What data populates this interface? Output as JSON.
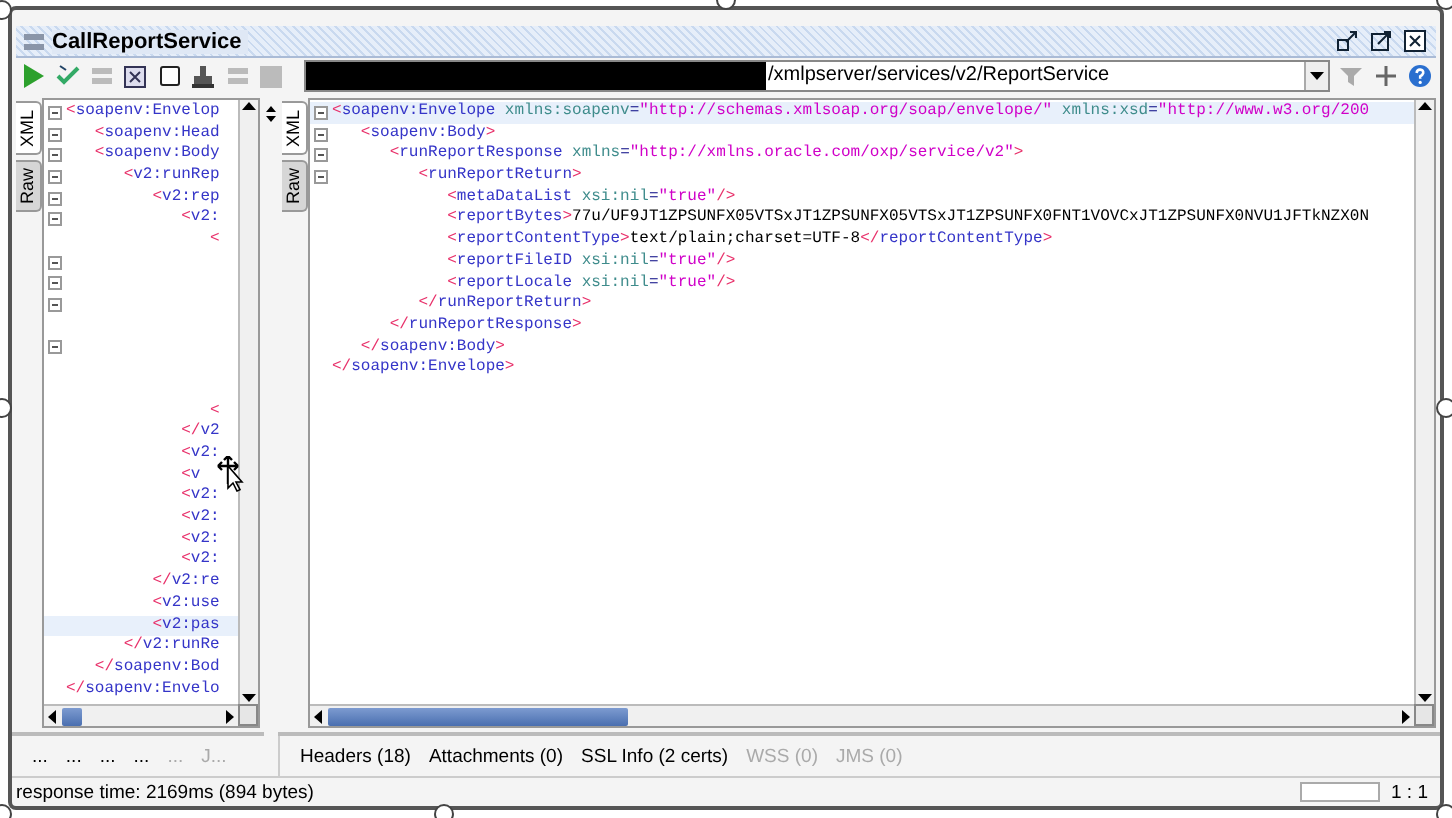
{
  "window": {
    "title": "CallReportService"
  },
  "toolbar": {
    "url": "/xmlpserver/services/v2/ReportService",
    "url_redacted": true
  },
  "request_editor": {
    "tabs": [
      {
        "label": "XML",
        "selected": true
      },
      {
        "label": "Raw",
        "selected": false
      }
    ],
    "lines": [
      {
        "fold": true,
        "segments": [
          {
            "kind": "bracket",
            "text": "<"
          },
          {
            "kind": "tag",
            "text": "soapenv:Envelop"
          }
        ],
        "children": [
          {
            "fold": true,
            "segments": [
              {
                "kind": "bracket",
                "text": "<"
              },
              {
                "kind": "tag",
                "text": "soapenv:Head"
              }
            ]
          },
          {
            "fold": true,
            "segments": [
              {
                "kind": "bracket",
                "text": "<"
              },
              {
                "kind": "tag",
                "text": "soapenv:Body"
              }
            ],
            "children": [
              {
                "fold": true,
                "segments": [
                  {
                    "kind": "bracket",
                    "text": "<"
                  },
                  {
                    "kind": "tag",
                    "text": "v2:runRep"
                  }
                ],
                "children": [
                  {
                    "fold": true,
                    "segments": [
                      {
                        "kind": "bracket",
                        "text": "<"
                      },
                      {
                        "kind": "tag",
                        "text": "v2:rep"
                      }
                    ],
                    "children": [
                      {
                        "fold": true,
                        "segments": [
                          {
                            "kind": "bracket",
                            "text": "<"
                          },
                          {
                            "kind": "tag",
                            "text": "v2:"
                          }
                        ],
                        "children": [
                          {
                            "fold": false,
                            "segments": [
                              {
                                "kind": "bracket",
                                "text": "<"
                              }
                            ]
                          },
                          {
                            "fold": true
                          },
                          {
                            "fold": true
                          },
                          {
                            "fold": true
                          },
                          {
                            "fold": false
                          },
                          {
                            "fold": true
                          },
                          {
                            "fold": false
                          },
                          {
                            "fold": false
                          },
                          {
                            "fold": false,
                            "segments": [
                              {
                                "kind": "bracket",
                                "text": "<"
                              }
                            ]
                          }
                        ]
                      },
                      {
                        "fold": false,
                        "segments": [
                          {
                            "kind": "bracket",
                            "text": "</"
                          },
                          {
                            "kind": "tag",
                            "text": "v2"
                          }
                        ]
                      },
                      {
                        "fold": false,
                        "segments": [
                          {
                            "kind": "bracket",
                            "text": "<"
                          },
                          {
                            "kind": "tag",
                            "text": "v2:"
                          }
                        ]
                      },
                      {
                        "fold": false,
                        "segments": [
                          {
                            "kind": "bracket",
                            "text": "<"
                          },
                          {
                            "kind": "tag",
                            "text": "v"
                          }
                        ]
                      },
                      {
                        "fold": false,
                        "segments": [
                          {
                            "kind": "bracket",
                            "text": "<"
                          },
                          {
                            "kind": "tag",
                            "text": "v2:"
                          }
                        ]
                      },
                      {
                        "fold": false,
                        "segments": [
                          {
                            "kind": "bracket",
                            "text": "<"
                          },
                          {
                            "kind": "tag",
                            "text": "v2:"
                          }
                        ]
                      },
                      {
                        "fold": false,
                        "segments": [
                          {
                            "kind": "bracket",
                            "text": "<"
                          },
                          {
                            "kind": "tag",
                            "text": "v2:"
                          }
                        ]
                      },
                      {
                        "fold": false,
                        "segments": [
                          {
                            "kind": "bracket",
                            "text": "<"
                          },
                          {
                            "kind": "tag",
                            "text": "v2:"
                          }
                        ]
                      }
                    ]
                  },
                  {
                    "fold": false,
                    "segments": [
                      {
                        "kind": "bracket",
                        "text": "</"
                      },
                      {
                        "kind": "tag",
                        "text": "v2:re"
                      }
                    ]
                  },
                  {
                    "fold": false,
                    "segments": [
                      {
                        "kind": "bracket",
                        "text": "<"
                      },
                      {
                        "kind": "tag",
                        "text": "v2:use"
                      }
                    ]
                  },
                  {
                    "fold": false,
                    "highlighted": true,
                    "segments": [
                      {
                        "kind": "bracket",
                        "text": "<"
                      },
                      {
                        "kind": "tag",
                        "text": "v2:pas"
                      }
                    ]
                  }
                ]
              },
              {
                "fold": false,
                "segments": [
                  {
                    "kind": "bracket",
                    "text": "</"
                  },
                  {
                    "kind": "tag",
                    "text": "v2:runRe"
                  }
                ]
              }
            ]
          },
          {
            "fold": false,
            "segments": [
              {
                "kind": "bracket",
                "text": "</"
              },
              {
                "kind": "tag",
                "text": "soapenv:Bod"
              }
            ]
          }
        ]
      },
      {
        "fold": false,
        "segments": [
          {
            "kind": "bracket",
            "text": "</"
          },
          {
            "kind": "tag",
            "text": "soapenv:Envelo"
          }
        ]
      }
    ],
    "bottom_tabs": [
      {
        "label": "...",
        "disabled": false
      },
      {
        "label": "...",
        "disabled": false
      },
      {
        "label": "...",
        "disabled": false
      },
      {
        "label": "...",
        "disabled": false
      },
      {
        "label": "...",
        "disabled": true
      },
      {
        "label": "J...",
        "disabled": true
      }
    ]
  },
  "response_editor": {
    "tabs": [
      {
        "label": "XML",
        "selected": true
      },
      {
        "label": "Raw",
        "selected": false
      }
    ],
    "lines": [
      {
        "fold": true,
        "highlighted": true,
        "segments": [
          {
            "kind": "bracket",
            "text": "<"
          },
          {
            "kind": "tag",
            "text": "soapenv:Envelope"
          },
          {
            "kind": "attr",
            "text": " xmlns:soapenv"
          },
          {
            "kind": "eq",
            "text": "="
          },
          {
            "kind": "value",
            "text": "\"http://schemas.xmlsoap.org/soap/envelope/\""
          },
          {
            "kind": "attr",
            "text": " xmlns:xsd"
          },
          {
            "kind": "eq",
            "text": "="
          },
          {
            "kind": "value",
            "text": "\"http://www.w3.org/200"
          }
        ],
        "children": [
          {
            "fold": true,
            "segments": [
              {
                "kind": "bracket",
                "text": "<"
              },
              {
                "kind": "tag",
                "text": "soapenv:Body"
              },
              {
                "kind": "bracket",
                "text": ">"
              }
            ],
            "children": [
              {
                "fold": true,
                "segments": [
                  {
                    "kind": "bracket",
                    "text": "<"
                  },
                  {
                    "kind": "tag",
                    "text": "runReportResponse"
                  },
                  {
                    "kind": "attr",
                    "text": " xmlns"
                  },
                  {
                    "kind": "eq",
                    "text": "="
                  },
                  {
                    "kind": "value",
                    "text": "\"http://xmlns.oracle.com/oxp/service/v2\""
                  },
                  {
                    "kind": "bracket",
                    "text": ">"
                  }
                ],
                "children": [
                  {
                    "fold": true,
                    "segments": [
                      {
                        "kind": "bracket",
                        "text": "<"
                      },
                      {
                        "kind": "tag",
                        "text": "runReportReturn"
                      },
                      {
                        "kind": "bracket",
                        "text": ">"
                      }
                    ],
                    "children": [
                      {
                        "fold": false,
                        "segments": [
                          {
                            "kind": "bracket",
                            "text": "<"
                          },
                          {
                            "kind": "tag",
                            "text": "metaDataList"
                          },
                          {
                            "kind": "attr",
                            "text": " xsi:nil"
                          },
                          {
                            "kind": "eq",
                            "text": "="
                          },
                          {
                            "kind": "value",
                            "text": "\"true\""
                          },
                          {
                            "kind": "bracket",
                            "text": "/>"
                          }
                        ]
                      },
                      {
                        "fold": false,
                        "segments": [
                          {
                            "kind": "bracket",
                            "text": "<"
                          },
                          {
                            "kind": "tag",
                            "text": "reportBytes"
                          },
                          {
                            "kind": "bracket",
                            "text": ">"
                          },
                          {
                            "kind": "text",
                            "text": "77u/UF9JT1ZPSUNFX05VTSxJT1ZPSUNFX05VTSxJT1ZPSUNFX0FNT1VOVCxJT1ZPSUNFX0NVU1JFTkNZX0N"
                          }
                        ]
                      },
                      {
                        "fold": false,
                        "segments": [
                          {
                            "kind": "bracket",
                            "text": "<"
                          },
                          {
                            "kind": "tag",
                            "text": "reportContentType"
                          },
                          {
                            "kind": "bracket",
                            "text": ">"
                          },
                          {
                            "kind": "text",
                            "text": "text/plain;charset=UTF-8"
                          },
                          {
                            "kind": "bracket",
                            "text": "</"
                          },
                          {
                            "kind": "tag",
                            "text": "reportContentType"
                          },
                          {
                            "kind": "bracket",
                            "text": ">"
                          }
                        ]
                      },
                      {
                        "fold": false,
                        "segments": [
                          {
                            "kind": "bracket",
                            "text": "<"
                          },
                          {
                            "kind": "tag",
                            "text": "reportFileID"
                          },
                          {
                            "kind": "attr",
                            "text": " xsi:nil"
                          },
                          {
                            "kind": "eq",
                            "text": "="
                          },
                          {
                            "kind": "value",
                            "text": "\"true\""
                          },
                          {
                            "kind": "bracket",
                            "text": "/>"
                          }
                        ]
                      },
                      {
                        "fold": false,
                        "segments": [
                          {
                            "kind": "bracket",
                            "text": "<"
                          },
                          {
                            "kind": "tag",
                            "text": "reportLocale"
                          },
                          {
                            "kind": "attr",
                            "text": " xsi:nil"
                          },
                          {
                            "kind": "eq",
                            "text": "="
                          },
                          {
                            "kind": "value",
                            "text": "\"true\""
                          },
                          {
                            "kind": "bracket",
                            "text": "/>"
                          }
                        ]
                      }
                    ]
                  },
                  {
                    "fold": false,
                    "segments": [
                      {
                        "kind": "bracket",
                        "text": "</"
                      },
                      {
                        "kind": "tag",
                        "text": "runReportReturn"
                      },
                      {
                        "kind": "bracket",
                        "text": ">"
                      }
                    ]
                  }
                ]
              },
              {
                "fold": false,
                "segments": [
                  {
                    "kind": "bracket",
                    "text": "</"
                  },
                  {
                    "kind": "tag",
                    "text": "runReportResponse"
                  },
                  {
                    "kind": "bracket",
                    "text": ">"
                  }
                ]
              }
            ]
          },
          {
            "fold": false,
            "segments": [
              {
                "kind": "bracket",
                "text": "</"
              },
              {
                "kind": "tag",
                "text": "soapenv:Body"
              },
              {
                "kind": "bracket",
                "text": ">"
              }
            ]
          }
        ]
      },
      {
        "fold": false,
        "segments": [
          {
            "kind": "bracket",
            "text": "</"
          },
          {
            "kind": "tag",
            "text": "soapenv:Envelope"
          },
          {
            "kind": "bracket",
            "text": ">"
          }
        ]
      }
    ],
    "bottom_tabs": [
      {
        "label": "Headers (18)",
        "disabled": false
      },
      {
        "label": "Attachments (0)",
        "disabled": false
      },
      {
        "label": "SSL Info (2 certs)",
        "disabled": false
      },
      {
        "label": "WSS (0)",
        "disabled": true
      },
      {
        "label": "JMS (0)",
        "disabled": true
      }
    ]
  },
  "status_bar": {
    "response_time": "response time: 2169ms (894 bytes)",
    "position": "1 : 1"
  }
}
